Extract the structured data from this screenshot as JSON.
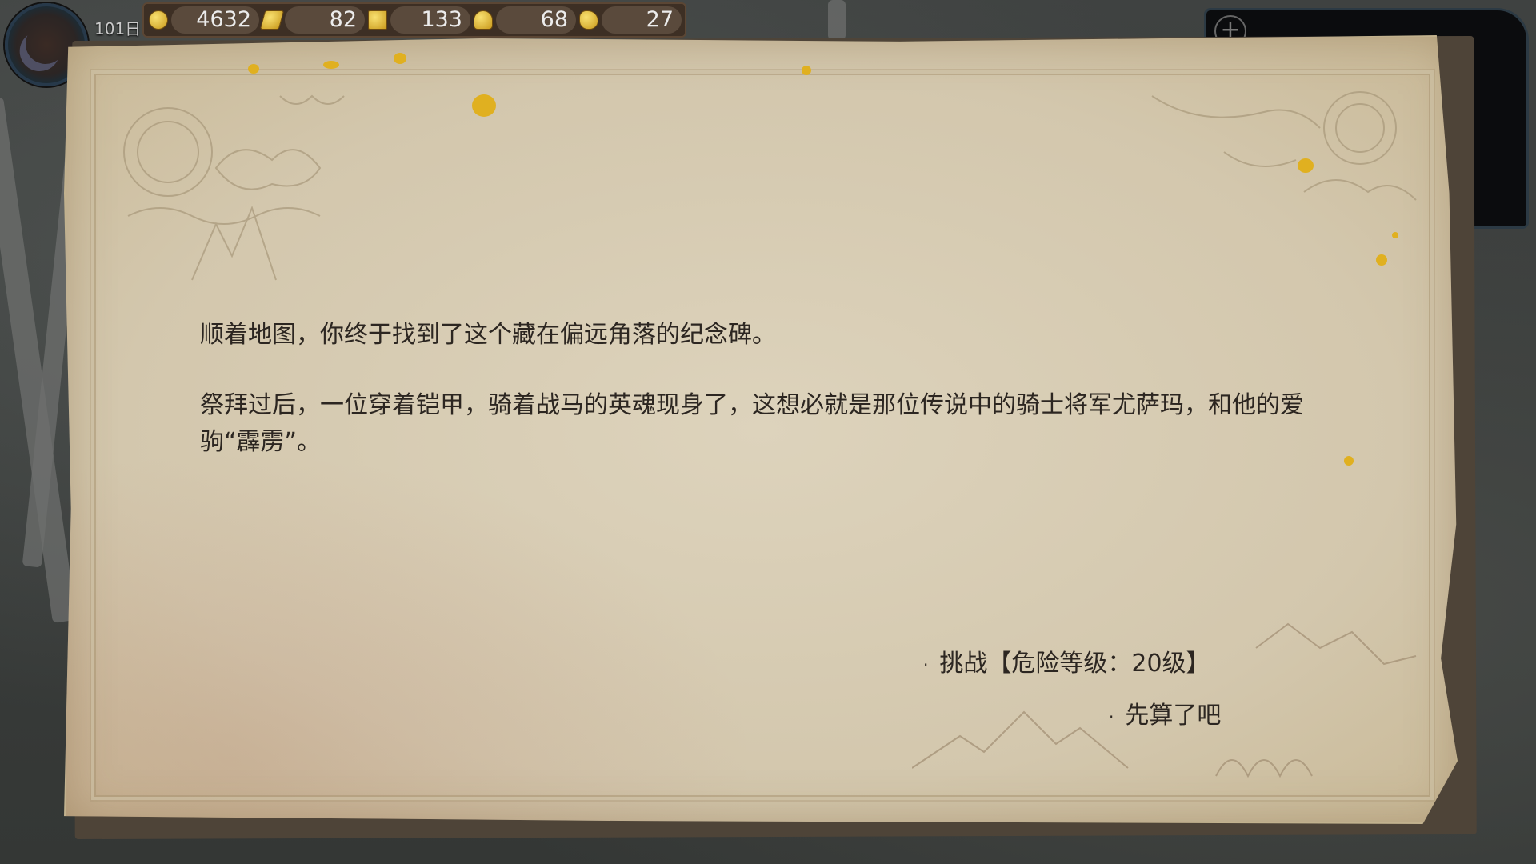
{
  "hud": {
    "day": "101日",
    "resources": [
      {
        "icon": "gold-coin-icon",
        "value": "4632"
      },
      {
        "icon": "gold-bars-icon",
        "value": "82"
      },
      {
        "icon": "ingot-stack-icon",
        "value": "133"
      },
      {
        "icon": "bell-icon",
        "value": "68"
      },
      {
        "icon": "horn-icon",
        "value": "27"
      }
    ]
  },
  "event": {
    "paragraphs": [
      "顺着地图，你终于找到了这个藏在偏远角落的纪念碑。",
      "祭拜过后，一位穿着铠甲，骑着战马的英魂现身了，这想必就是那位传说中的骑士将军尤萨玛，和他的爱驹“霹雳”。"
    ],
    "choices": [
      {
        "label": "挑战【危险等级：20级】"
      },
      {
        "label": "先算了吧"
      }
    ],
    "bullet": "·"
  },
  "colors": {
    "parchment": "#d8ceb6",
    "text": "#2c2621",
    "gold_accent": "#e0b020"
  }
}
